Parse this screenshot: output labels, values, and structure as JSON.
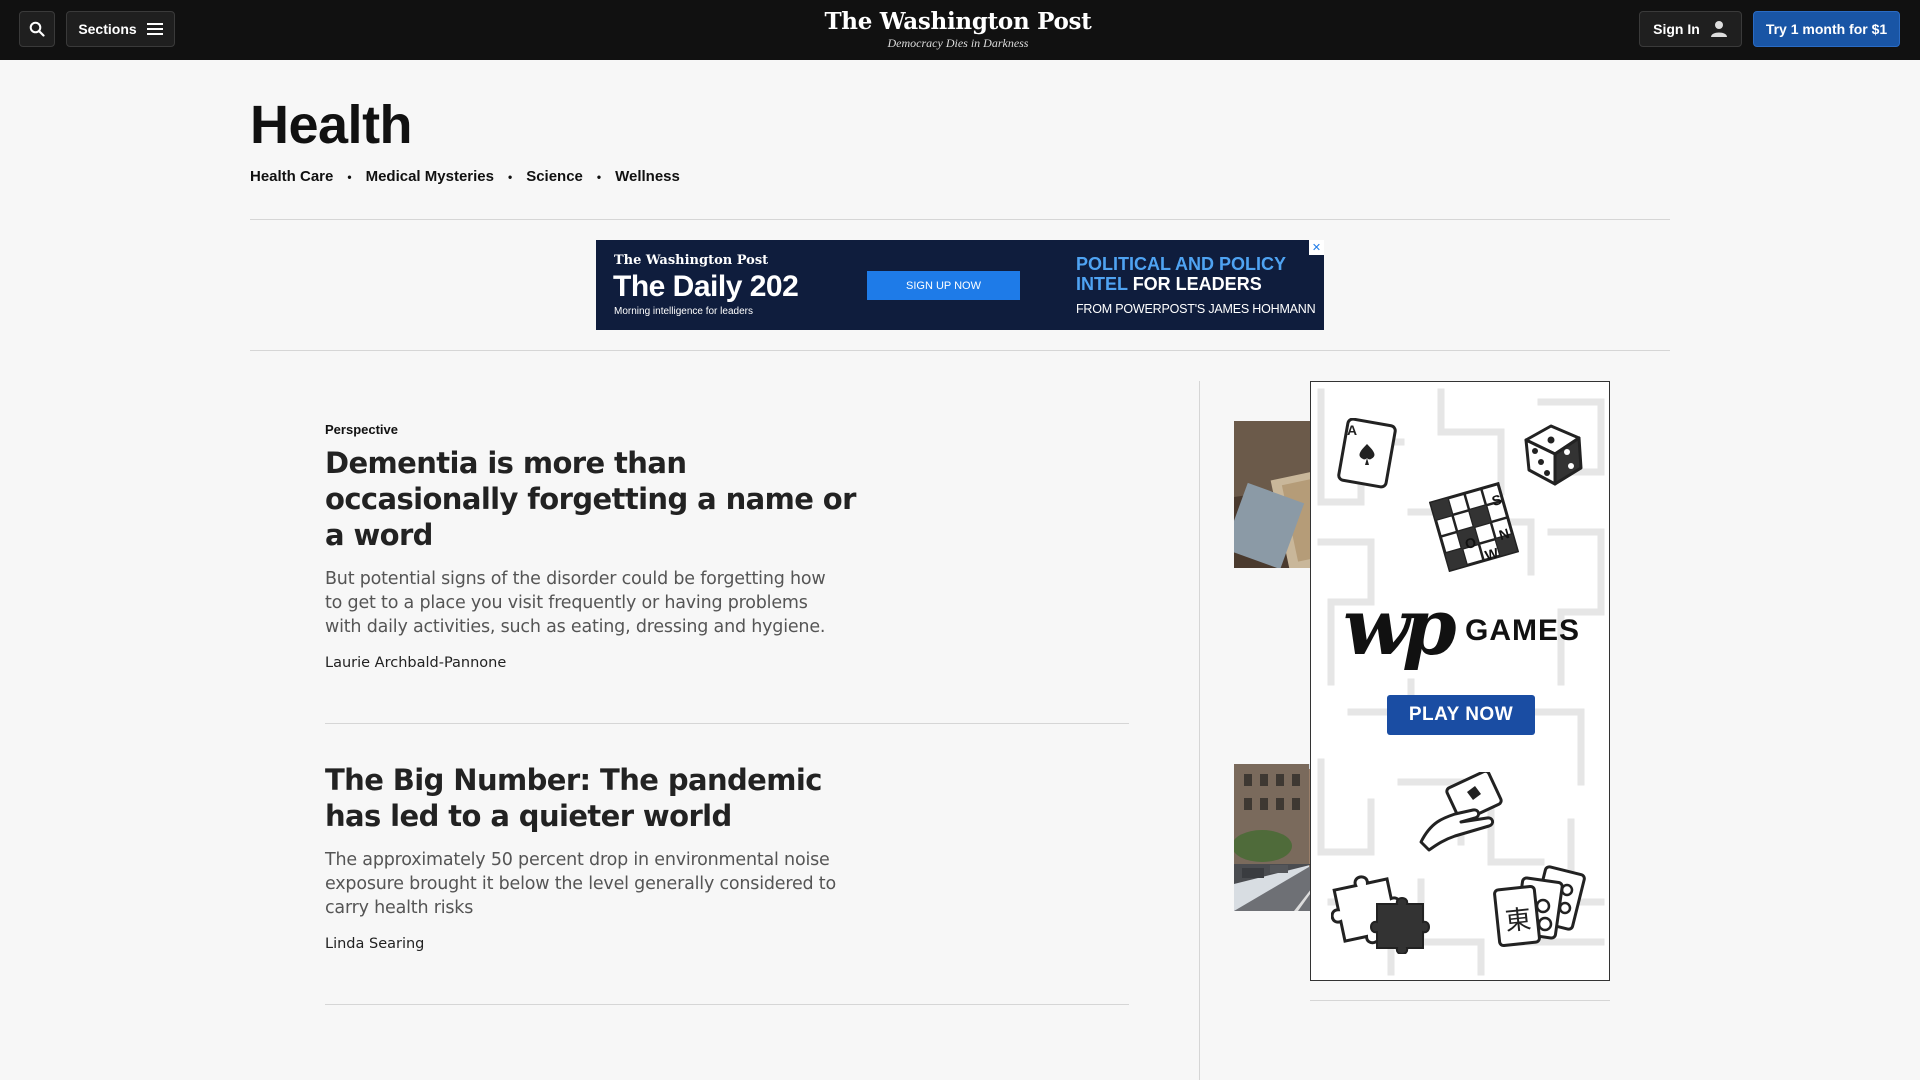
{
  "topnav": {
    "sections_label": "Sections",
    "brand_name": "The Washington Post",
    "brand_tagline": "Democracy Dies in Darkness",
    "signin_label": "Sign In",
    "subscribe_label": "Try 1 month for $1"
  },
  "section": {
    "title": "Health",
    "subnav": [
      "Health Care",
      "Medical Mysteries",
      "Science",
      "Wellness"
    ]
  },
  "banner_ad": {
    "logo": "The Washington Post",
    "title": "The Daily 202",
    "subtitle": "Morning intelligence for leaders",
    "cta": "SIGN UP NOW",
    "headline_blue_1": "POLITICAL AND POLICY",
    "headline_blue_2": "INTEL",
    "headline_white": "FOR LEADERS",
    "from": "FROM POWERPOST'S JAMES HOHMANN",
    "close": "✕"
  },
  "articles": [
    {
      "kicker": "Perspective",
      "headline": "Dementia is more than occasionally forgetting a name or a word",
      "blurb": "But potential signs of the disorder could be forgetting how to get to a place you visit frequently or having problems with daily activities, such as eating, dressing and hygiene.",
      "byline": "Laurie Archbald-Pannone"
    },
    {
      "kicker": "",
      "headline": "The Big Number: The pandemic has led to a quieter world",
      "blurb": "The approximately 50 percent drop in environmental noise exposure brought it below the level generally considered to carry health risks",
      "byline": "Linda Searing"
    }
  ],
  "games_ad": {
    "wordmark": "wp",
    "title": "GAMES",
    "cta": "PLAY NOW",
    "crossword_letters": [
      "S",
      "O",
      "N",
      "W"
    ],
    "card_rank": "A",
    "tile_glyph": "東"
  },
  "colors": {
    "nav_bg": "#111111",
    "accent_blue": "#1955a5",
    "ad_navy": "#0f1d3d",
    "ad_light_blue": "#4fa3f2"
  },
  "icons": [
    "search-icon",
    "hamburger-icon",
    "user-icon",
    "close-icon"
  ]
}
